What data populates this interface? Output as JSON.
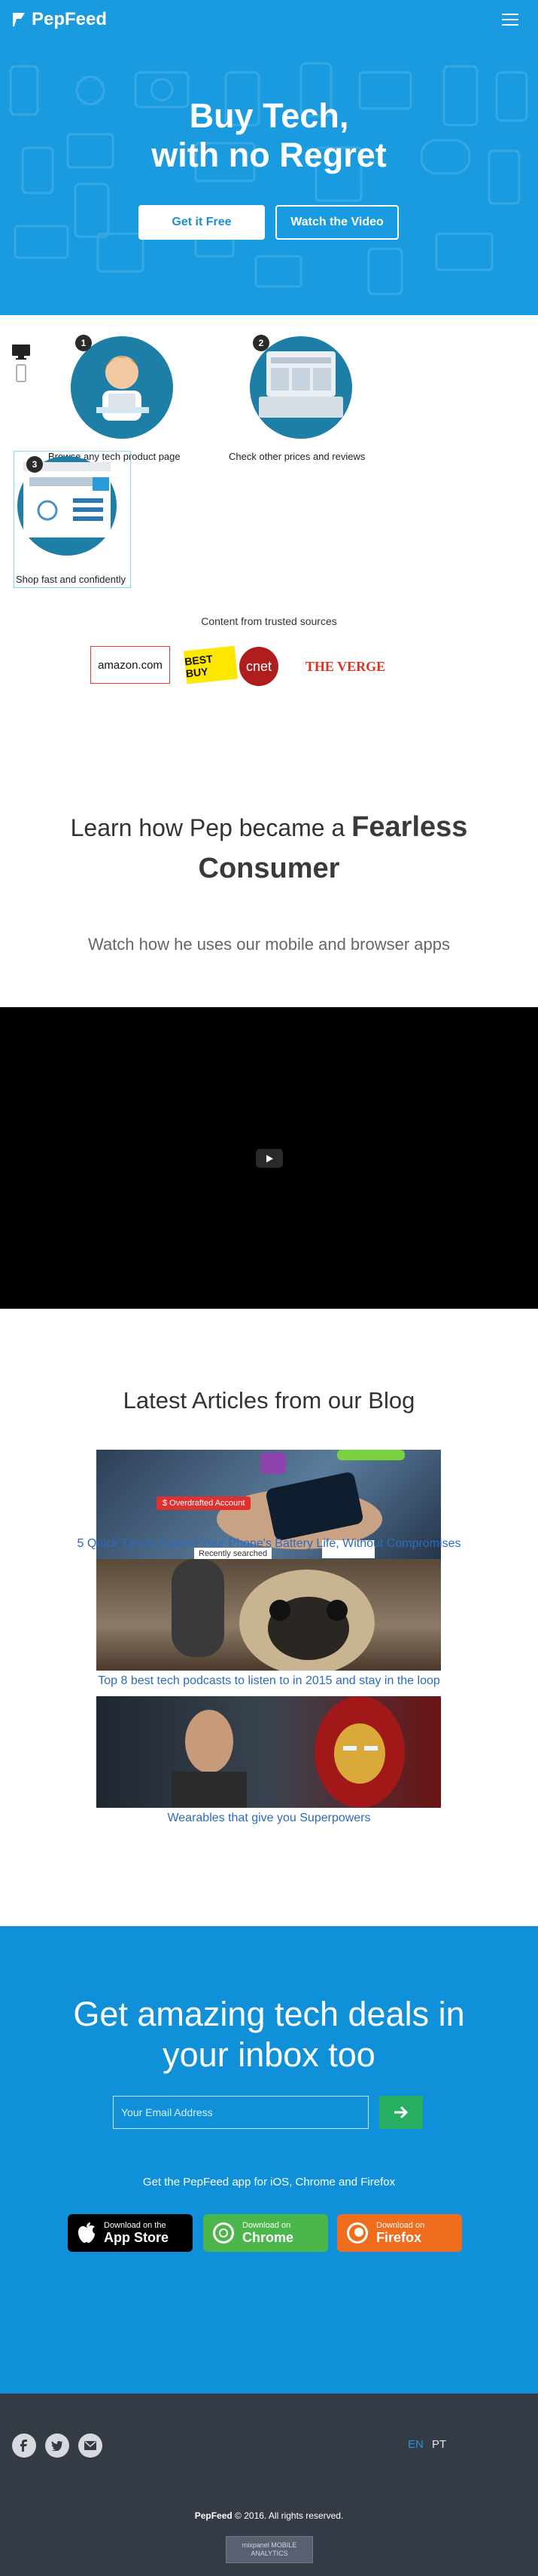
{
  "header": {
    "brand": "PepFeed",
    "menu_icon": "hamburger-menu-icon"
  },
  "hero": {
    "title_line1": "Buy Tech,",
    "title_line2": "with no Regret",
    "primary_button": "Get it Free",
    "secondary_button": "Watch the Video"
  },
  "steps": [
    {
      "number": "1",
      "label": "Browse any tech product page"
    },
    {
      "number": "2",
      "label": "Check other prices and reviews"
    },
    {
      "number": "3",
      "label": "Shop fast and confidently"
    }
  ],
  "sources": {
    "title": "Content from trusted sources",
    "logos": [
      "amazon.com",
      "BEST BUY",
      "cnet",
      "THE VERGE"
    ]
  },
  "pep": {
    "title_prefix": "Learn how Pep became a",
    "title_bold": "Fearless Consumer",
    "subtitle": "Watch how he uses our mobile and browser apps"
  },
  "blog": {
    "title": "Latest Articles from our Blog",
    "image_texts": {
      "overdraft": "$ Overdrafted Account",
      "recent": "Recently searched"
    },
    "articles": [
      {
        "title": "5 Quick Tips to Extend Your Phone's Battery Life, Without Compromises"
      },
      {
        "title": "Top 8 best tech podcasts to listen to in 2015 and stay in the loop"
      },
      {
        "title": "Wearables that give you Superpowers"
      }
    ]
  },
  "newsletter": {
    "title_line1": "Get amazing tech deals in",
    "title_line2": "your inbox too",
    "email_placeholder": "Your Email Address",
    "apps_line": "Get the PepFeed app for iOS, Chrome and Firefox",
    "stores": [
      {
        "small": "Download on the",
        "big": "App Store",
        "color": "#000000"
      },
      {
        "small": "Download on",
        "big": "Chrome",
        "color": "#4bb74a"
      },
      {
        "small": "Download on",
        "big": "Firefox",
        "color": "#f06d1e"
      }
    ]
  },
  "footer": {
    "languages": [
      "EN",
      "PT"
    ],
    "brand": "PepFeed",
    "copyright": "© 2016. All rights reserved.",
    "badge": "mixpanel MOBILE ANALYTICS"
  },
  "colors": {
    "hero_bg": "#1a9be0",
    "newsletter_bg": "#0f90d8",
    "footer_bg": "#353b45",
    "link": "#2c6bbd",
    "submit": "#27ae60",
    "active_lang": "#1a9be0"
  }
}
